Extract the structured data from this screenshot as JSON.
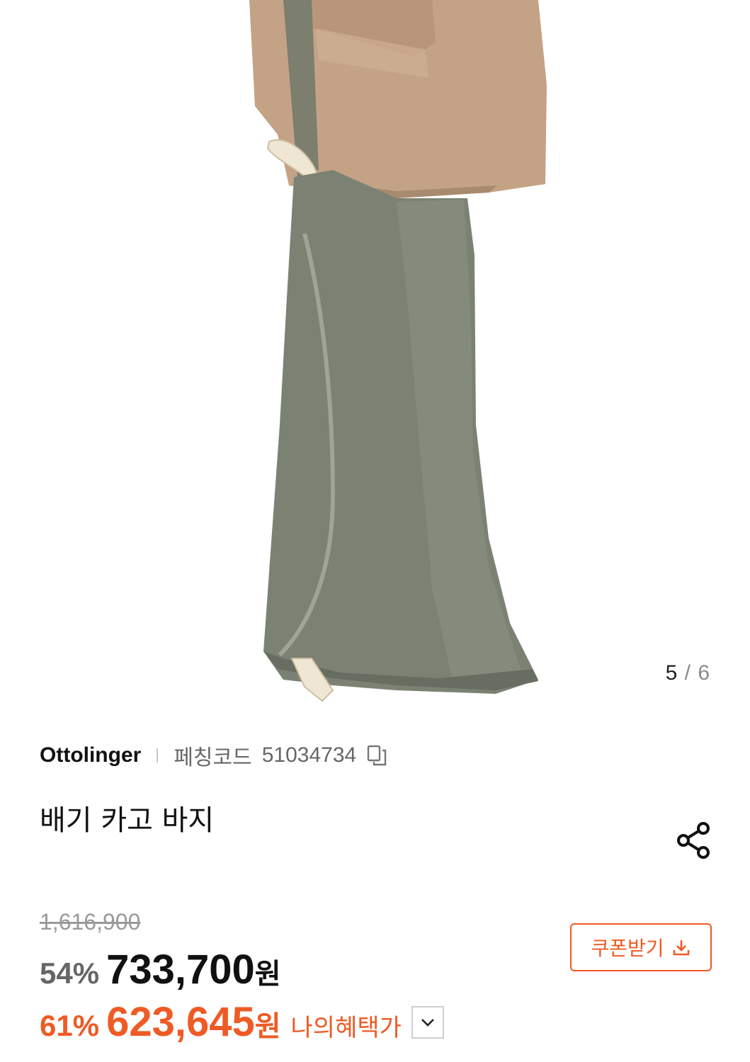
{
  "gallery": {
    "current_page": "5",
    "separator": "/",
    "total_pages": "6"
  },
  "product": {
    "brand": "Ottolinger",
    "code_label": "페칭코드",
    "code_value": "51034734",
    "title": "배기 카고 바지"
  },
  "pricing": {
    "original_price": "1,616,900",
    "sale_discount": "54%",
    "sale_price": "733,700",
    "currency": "원",
    "benefit_discount": "61%",
    "benefit_price": "623,645",
    "benefit_label": "나의혜택가"
  },
  "coupon": {
    "label": "쿠폰받기"
  },
  "colors": {
    "accent": "#ee5b24",
    "muted": "#9a9a9a"
  },
  "icons": {
    "copy": "copy-icon",
    "share": "share-icon",
    "chevron": "chevron-down-icon",
    "download": "download-icon"
  }
}
